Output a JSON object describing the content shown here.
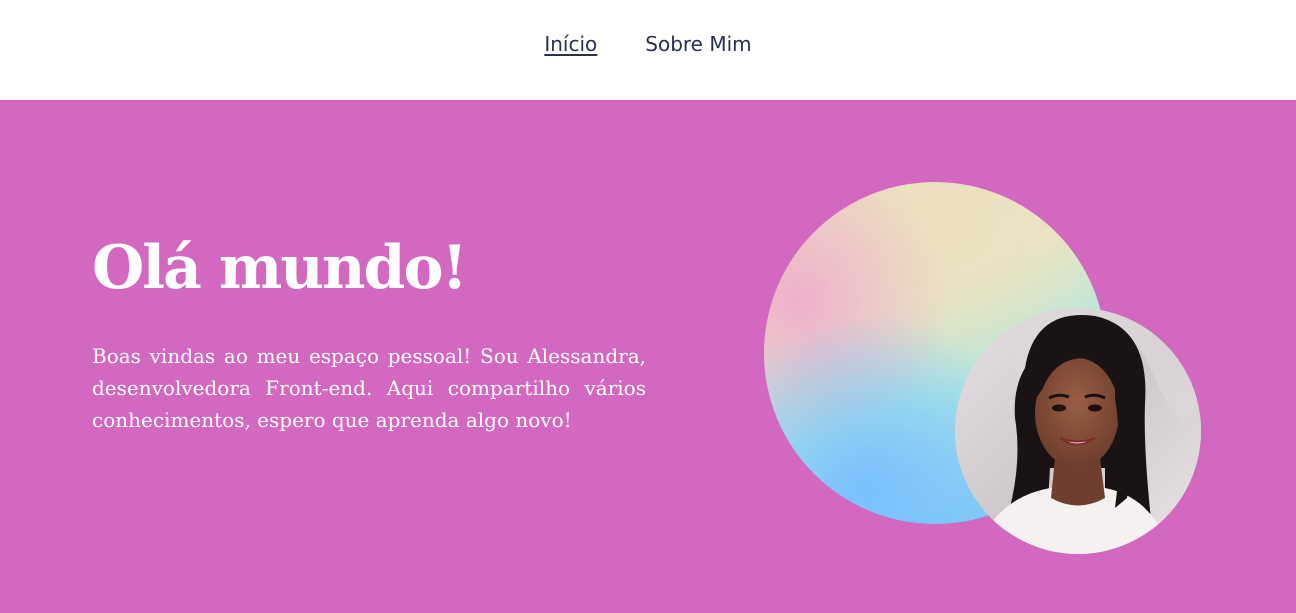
{
  "nav": {
    "items": [
      {
        "label": "Início",
        "active": true
      },
      {
        "label": "Sobre Mim",
        "active": false
      }
    ]
  },
  "hero": {
    "title": "Olá mundo!",
    "text": "Boas vindas ao meu espaço pessoal! Sou Alessandra, desenvolvedora Front-end. Aqui compartilho vários conhecimentos, espero que aprenda algo novo!",
    "background_color": "#d268c0",
    "text_color": "#ffffff"
  },
  "avatar": {
    "icon": "profile-photo"
  }
}
